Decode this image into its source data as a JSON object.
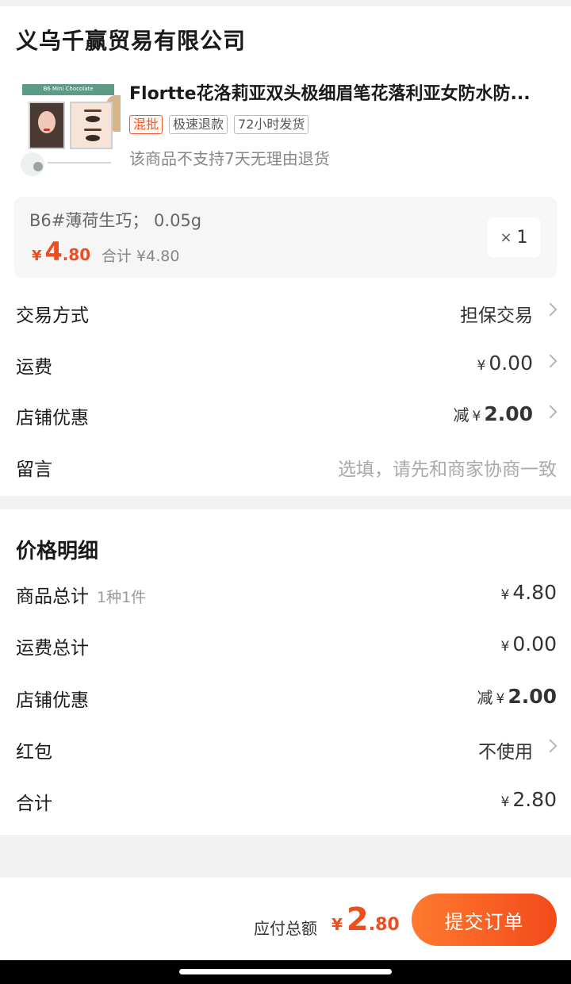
{
  "shop": {
    "name": "义乌千赢贸易有限公司"
  },
  "product": {
    "thumb_text": "B6 Mini Chocolate",
    "title": "Flortte花洛莉亚双头极细眉笔花落利亚女防水防...",
    "tags": [
      "混批",
      "极速退款",
      "72小时发货"
    ],
    "return_note": "该商品不支持7天无理由退货",
    "spec": "B6#薄荷生巧； 0.05g",
    "price_currency": "¥",
    "price_int": "4",
    "price_dec": ".80",
    "subtotal": "合计 ¥4.80",
    "qty_x": "×",
    "qty": "1"
  },
  "order_rows": {
    "trade_label": "交易方式",
    "trade_value": "担保交易",
    "shipping_label": "运费",
    "shipping_currency": "¥",
    "shipping_value": "0.00",
    "discount_label": "店铺优惠",
    "discount_prefix": "减",
    "discount_currency": "¥",
    "discount_value": "2.00",
    "message_label": "留言",
    "message_placeholder": "选填，请先和商家协商一致"
  },
  "price_detail": {
    "title": "价格明细",
    "goods_label": "商品总计",
    "goods_count": "1种1件",
    "goods_currency": "¥",
    "goods_value": "4.80",
    "freight_label": "运费总计",
    "freight_currency": "¥",
    "freight_value": "0.00",
    "discount_label": "店铺优惠",
    "discount_prefix": "减",
    "discount_currency": "¥",
    "discount_value": "2.00",
    "redpacket_label": "红包",
    "redpacket_value": "不使用",
    "total_label": "合计",
    "total_currency": "¥",
    "total_value": "2.80"
  },
  "footer": {
    "pay_label": "应付总额",
    "pay_currency": "¥",
    "pay_int": "2",
    "pay_dec": ".80",
    "submit_label": "提交订单"
  },
  "colors": {
    "accent": "#ee4d1d",
    "button_start": "#ff7a2f",
    "button_end": "#f24a1a"
  }
}
